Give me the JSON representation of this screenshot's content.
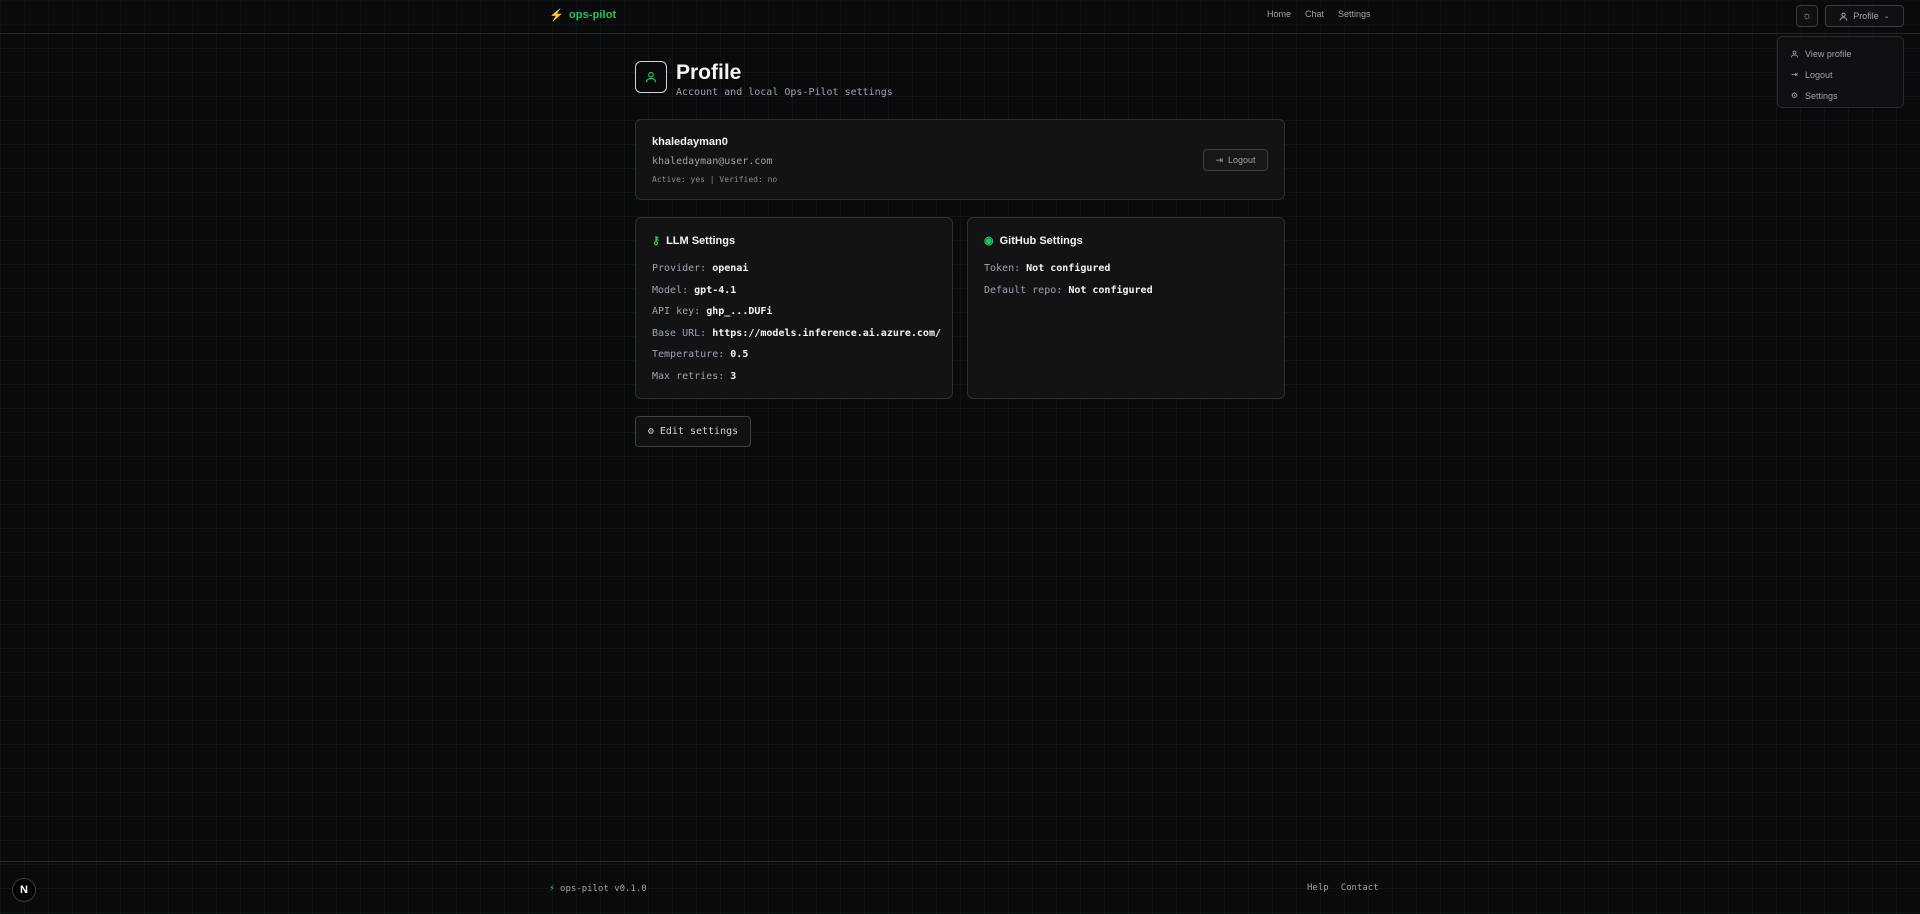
{
  "header": {
    "brand": "ops-pilot",
    "nav": [
      "Home",
      "Chat",
      "Settings"
    ],
    "profile_label": "Profile"
  },
  "dropdown": {
    "items": [
      {
        "label": "View profile",
        "icon": "user-icon"
      },
      {
        "label": "Logout",
        "icon": "logout-icon"
      },
      {
        "label": "Settings",
        "icon": "gear-icon"
      }
    ]
  },
  "page": {
    "title": "Profile",
    "subtitle": "Account and local Ops-Pilot settings"
  },
  "user": {
    "username": "khaledayman0",
    "email": "khaledayman@user.com",
    "status": "Active: yes | Verified: no",
    "logout_label": "Logout"
  },
  "llm": {
    "title": "LLM Settings",
    "rows": [
      {
        "key": "Provider:",
        "value": "openai"
      },
      {
        "key": "Model:",
        "value": "gpt-4.1"
      },
      {
        "key": "API key:",
        "value": "ghp_...DUFi"
      },
      {
        "key": "Base URL:",
        "value": "https://models.inference.ai.azure.com/"
      },
      {
        "key": "Temperature:",
        "value": "0.5"
      },
      {
        "key": "Max retries:",
        "value": "3"
      }
    ]
  },
  "github": {
    "title": "GitHub Settings",
    "rows": [
      {
        "key": "Token:",
        "value": "Not configured"
      },
      {
        "key": "Default repo:",
        "value": "Not configured"
      }
    ]
  },
  "edit_label": "Edit settings",
  "footer": {
    "brand": "ops-pilot v0.1.0",
    "links": [
      "Help",
      "Contact"
    ]
  },
  "next_badge": "N",
  "colors": {
    "accent": "#22c55e",
    "background": "#0a0a0d",
    "card": "#131316"
  }
}
